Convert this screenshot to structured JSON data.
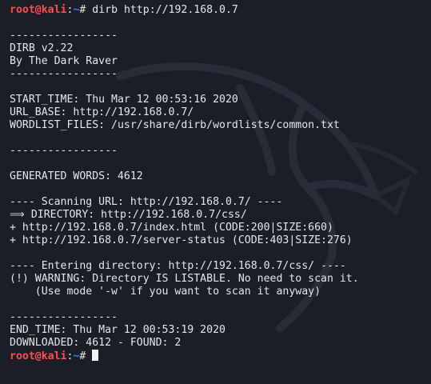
{
  "colors": {
    "background": "#1b1e27",
    "text": "#e6e6e6",
    "prompt_user": "#ff4d4d",
    "prompt_path": "#3d7bff"
  },
  "prompt": {
    "user_host": "root@kali",
    "sep": ":",
    "path": "~",
    "symbol": "# "
  },
  "command": "dirb http://192.168.0.7",
  "output": [
    "",
    "-----------------",
    "DIRB v2.22",
    "By The Dark Raver",
    "-----------------",
    "",
    "START_TIME: Thu Mar 12 00:53:16 2020",
    "URL_BASE: http://192.168.0.7/",
    "WORDLIST_FILES: /usr/share/dirb/wordlists/common.txt",
    "",
    "-----------------",
    "",
    "GENERATED WORDS: 4612",
    "",
    "---- Scanning URL: http://192.168.0.7/ ----",
    "⟹ DIRECTORY: http://192.168.0.7/css/",
    "+ http://192.168.0.7/index.html (CODE:200|SIZE:660)",
    "+ http://192.168.0.7/server-status (CODE:403|SIZE:276)",
    "",
    "---- Entering directory: http://192.168.0.7/css/ ----",
    "(!) WARNING: Directory IS LISTABLE. No need to scan it.",
    "    (Use mode '-w' if you want to scan it anyway)",
    "",
    "-----------------",
    "END_TIME: Thu Mar 12 00:53:19 2020",
    "DOWNLOADED: 4612 - FOUND: 2"
  ],
  "watermark_icon": "kali-dragon-icon"
}
